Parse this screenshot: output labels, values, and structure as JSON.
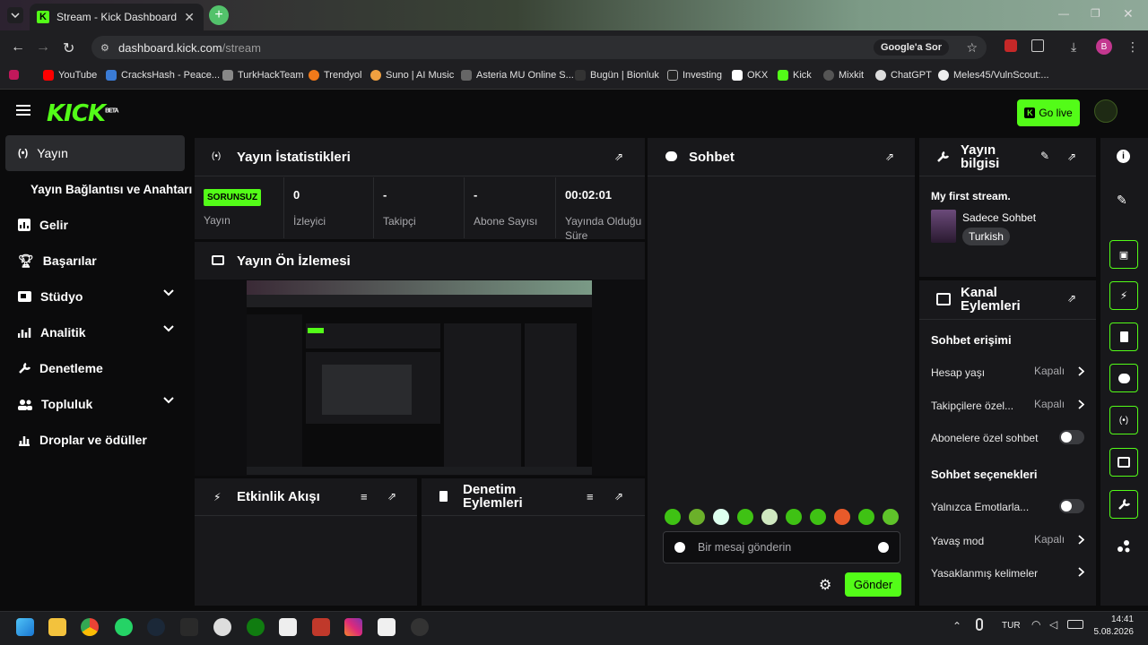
{
  "browser": {
    "tab_title": "Stream - Kick Dashboard",
    "url_domain": "dashboard.kick.com",
    "url_path": "/stream",
    "google_lens": "Google'a Sor",
    "profile_letter": "B",
    "bookmarks": [
      "YouTube",
      "CracksHash - Peace...",
      "TurkHackTeam",
      "Trendyol",
      "Suno | AI Music",
      "Asteria MU Online S...",
      "Bugün | Bionluk",
      "Investing",
      "OKX",
      "Kick",
      "Mixkit",
      "ChatGPT",
      "Meles45/VulnScout:..."
    ]
  },
  "header": {
    "logo": "KICK",
    "logo_beta": "BETA",
    "go_live": "Go live",
    "brand_color": "#53fc18"
  },
  "sidebar": {
    "items": [
      {
        "label": "Yayın",
        "icon": "broadcast-icon"
      },
      {
        "label": "Yayın Bağlantısı ve Anahtarı"
      },
      {
        "label": "Gelir",
        "icon": "chart-icon"
      },
      {
        "label": "Başarılar",
        "icon": "trophy-icon"
      },
      {
        "label": "Stüdyo",
        "icon": "studio-icon"
      },
      {
        "label": "Analitik",
        "icon": "analytics-icon"
      },
      {
        "label": "Denetleme",
        "icon": "wrench-icon"
      },
      {
        "label": "Topluluk",
        "icon": "community-icon"
      },
      {
        "label": "Droplar ve ödüller",
        "icon": "drops-icon"
      }
    ]
  },
  "stats": {
    "title": "Yayın İstatistikleri",
    "status_badge": "SORUNSUZ",
    "status_label": "Yayın",
    "viewers_value": "0",
    "viewers_label": "İzleyici",
    "followers_value": "-",
    "followers_label": "Takipçi",
    "subs_value": "-",
    "subs_label": "Abone Sayısı",
    "uptime_value": "00:02:01",
    "uptime_label": "Yayında Olduğu Süre"
  },
  "preview": {
    "title": "Yayın Ön İzlemesi"
  },
  "activity": {
    "title": "Etkinlik Akışı"
  },
  "moderation": {
    "title": "Denetim Eylemleri"
  },
  "chat": {
    "title": "Sohbet",
    "placeholder": "Bir mesaj gönderin",
    "send": "Gönder"
  },
  "stream_info": {
    "title": "Yayın bilgisi",
    "stream_title": "My first stream.",
    "category": "Sadece Sohbet",
    "language": "Turkish"
  },
  "channel_actions": {
    "title": "Kanal Eylemleri",
    "chat_access": "Sohbet erişimi",
    "account_age": "Hesap yaşı",
    "account_age_val": "Kapalı",
    "followers_only": "Takipçilere özel...",
    "followers_only_val": "Kapalı",
    "subs_only": "Abonelere özel sohbet",
    "chat_options": "Sohbet seçenekleri",
    "emote_only": "Yalnızca Emotlarla...",
    "slow_mode": "Yavaş mod",
    "slow_mode_val": "Kapalı",
    "banned_words": "Yasaklanmış kelimeler"
  },
  "taskbar": {
    "lang": "TUR",
    "time": "14:41",
    "date": "5.08.2026"
  }
}
